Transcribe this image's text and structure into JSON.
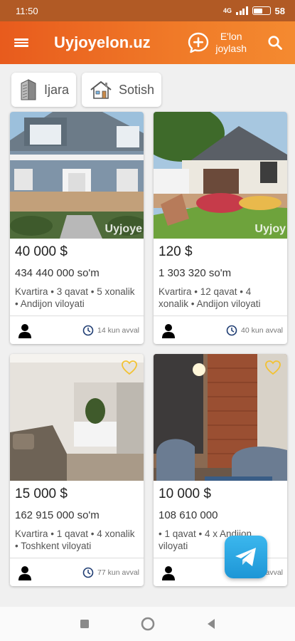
{
  "status_bar": {
    "time": "11:50",
    "network": "4G",
    "battery_percent": "58",
    "battery_level": 0.58
  },
  "app_bar": {
    "title": "Uyjoyelon.uz",
    "post_label_line1": "E'lon",
    "post_label_line2": "joylash"
  },
  "filters": [
    {
      "label": "Ijara",
      "icon": "building-icon"
    },
    {
      "label": "Sotish",
      "icon": "house-icon"
    }
  ],
  "listings": [
    {
      "price_usd": "40 000 $",
      "price_som": "434 440 000 so'm",
      "desc": "Kvartira • 3 qavat • 5 xonalik • Andijon viloyati",
      "time": "14 kun avval",
      "watermark": "Uyjoye",
      "favorite": false
    },
    {
      "price_usd": "120 $",
      "price_som": "1 303 320 so'm",
      "desc": "Kvartira • 12 qavat • 4 xonalik • Andijon viloyati",
      "time": "40 kun avval",
      "watermark": "Uyjoy",
      "favorite": false
    },
    {
      "price_usd": "15 000 $",
      "price_som": "162 915 000 so'm",
      "desc": "Kvartira • 1 qavat • 4 xonalik • Toshkent viloyati",
      "time": "77 kun avval",
      "watermark": "",
      "favorite": true
    },
    {
      "price_usd": "10 000 $",
      "price_som": "108 610 000",
      "desc": "• 1 qavat • 4 x Andijon viloyati",
      "time": "77 kun avval",
      "watermark": "",
      "favorite": true
    }
  ],
  "colors": {
    "brand": "#ef6c22",
    "status_bar": "#b15a25",
    "heart": "#f2c233",
    "telegram": "#2aa3e0"
  }
}
